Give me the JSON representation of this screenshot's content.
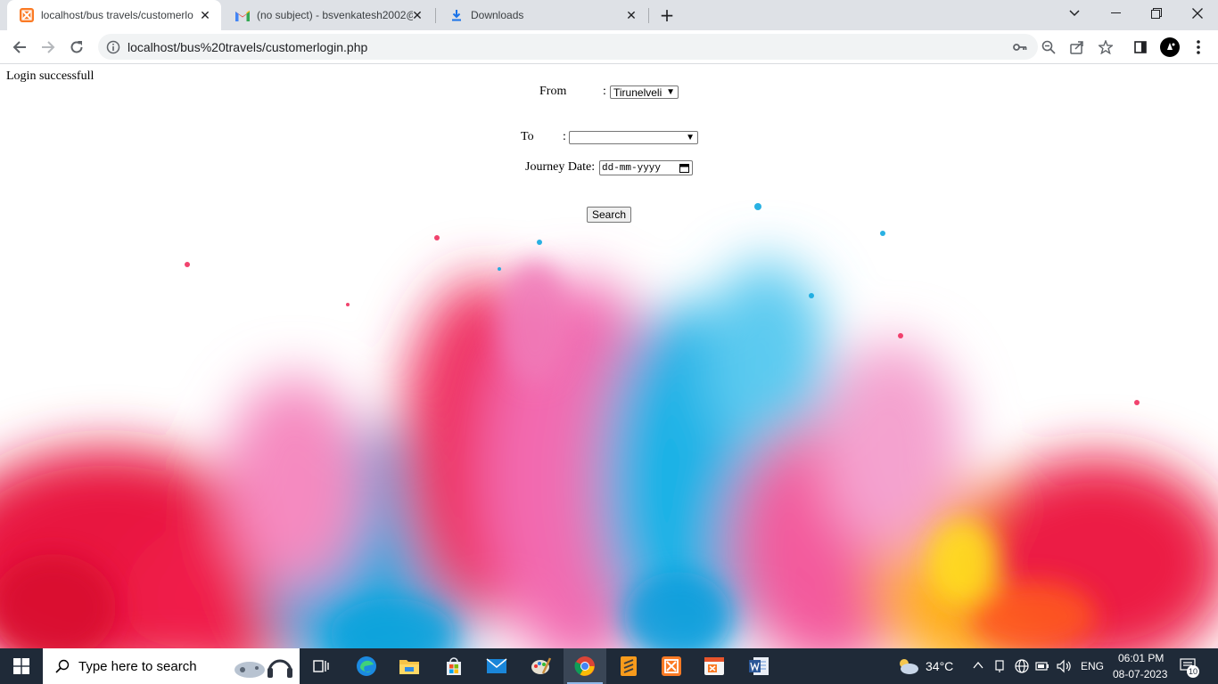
{
  "browser": {
    "tabs": [
      {
        "title": "localhost/bus travels/customerlo",
        "icon": "xampp-icon",
        "active": true
      },
      {
        "title": "(no subject) - bsvenkatesh2002@",
        "icon": "gmail-icon",
        "active": false
      },
      {
        "title": "Downloads",
        "icon": "download-icon",
        "active": false
      }
    ],
    "url": "localhost/bus%20travels/customerlogin.php"
  },
  "page": {
    "status_message": "Login successfull",
    "form": {
      "from_label": "From",
      "from_colon": ":",
      "from_value": "Tirunelveli",
      "to_label": "To",
      "to_colon": ":",
      "to_value": "",
      "date_label": "Journey Date:",
      "date_placeholder": "dd-mm-yyyy",
      "search_button": "Search"
    }
  },
  "taskbar": {
    "search_placeholder": "Type here to search",
    "weather": "34°C",
    "language": "ENG",
    "time": "06:01 PM",
    "date": "08-07-2023",
    "notification_count": "10"
  }
}
